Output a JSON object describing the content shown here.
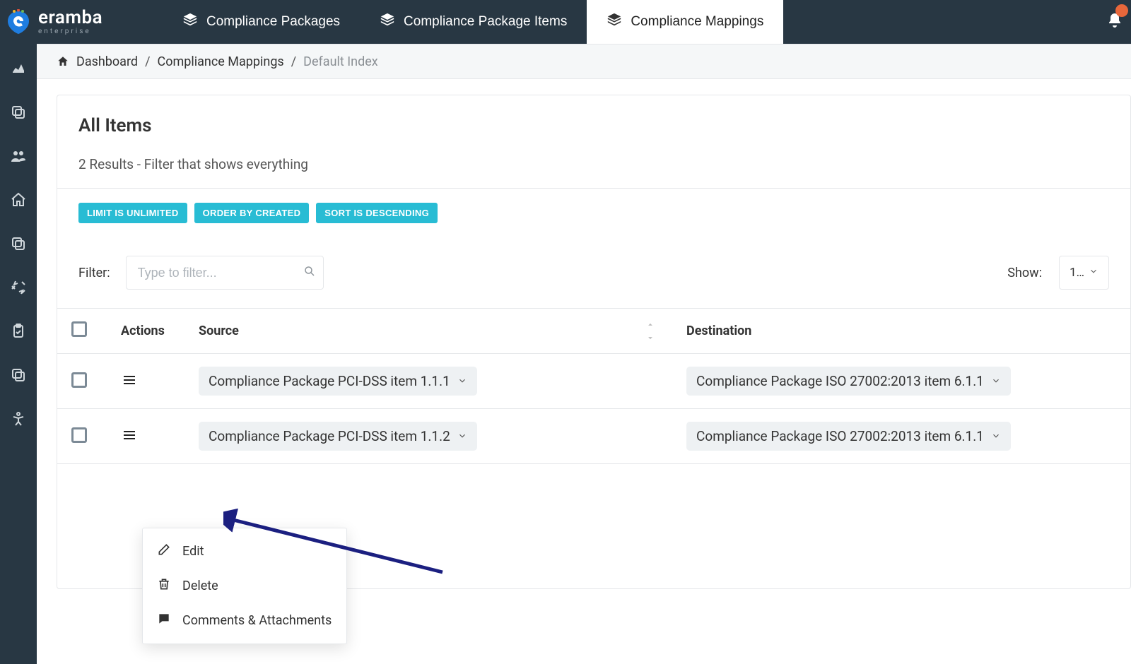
{
  "brand": {
    "name": "eramba",
    "tagline": "enterprise"
  },
  "topnav": {
    "packages": "Compliance Packages",
    "package_items": "Compliance Package Items",
    "mappings": "Compliance Mappings"
  },
  "breadcrumbs": {
    "dashboard": "Dashboard",
    "compliance_mappings": "Compliance Mappings",
    "default_index": "Default Index"
  },
  "page": {
    "title": "All Items",
    "result_summary": "2 Results - Filter that shows everything"
  },
  "chips": {
    "limit": "LIMIT IS UNLIMITED",
    "order": "ORDER BY CREATED",
    "sort": "SORT IS DESCENDING"
  },
  "filter": {
    "label": "Filter:",
    "placeholder": "Type to filter..."
  },
  "show": {
    "label": "Show:",
    "value": "1…"
  },
  "table": {
    "headers": {
      "actions": "Actions",
      "source": "Source",
      "destination": "Destination"
    },
    "rows": [
      {
        "source": "Compliance Package PCI-DSS item 1.1.1",
        "destination": "Compliance Package ISO 27002:2013 item 6.1.1"
      },
      {
        "source": "Compliance Package PCI-DSS item 1.1.2",
        "destination": "Compliance Package ISO 27002:2013 item 6.1.1"
      }
    ]
  },
  "actions_menu": {
    "edit": "Edit",
    "delete": "Delete",
    "comments": "Comments & Attachments"
  }
}
